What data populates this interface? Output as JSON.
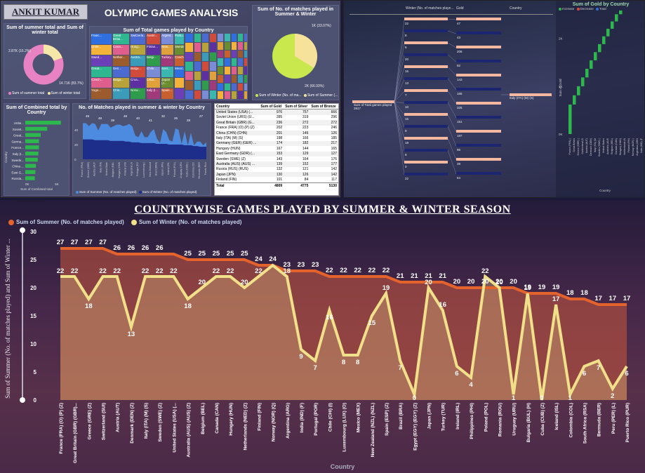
{
  "header": {
    "author": "ANKIT KUMAR",
    "title": "OLYMPIC GAMES ANALYSIS"
  },
  "colors": {
    "summer": "#e4622c",
    "winter": "#f1e08a",
    "green": "#2db84d",
    "pink": "#e882c2",
    "yellowgreen": "#c8e84d"
  },
  "donut": {
    "title": "Sum of summer total and Sum of winter total",
    "label_small": "2.87K (16.2%)",
    "label_large": "14.71K (83.7%)",
    "legend": [
      "Sum of summer total",
      "Sum of winter total"
    ]
  },
  "treemap": {
    "title": "Sum of Total games played by Country",
    "labels": [
      "Franc...",
      "Unite...",
      "Swed...",
      "Great...",
      "Czech...",
      "Yugo...",
      "Great Britai...",
      "Cana...",
      "Nether...",
      "Den...",
      "Bulga...",
      "Chin...",
      "Switzerla...",
      "Hung...",
      "Austra...",
      "Bulga...",
      "Croa...",
      "Norw...",
      "Austri...",
      "Finlan...",
      "Belgi...",
      "Chile...",
      "Leba...",
      "Italy (I...",
      "Argent...",
      "New...",
      "Turkey...",
      "Sovi...",
      "Japan (J...",
      "Spain...",
      "Portu...",
      "Swede...",
      "Czech...",
      "Mexic..."
    ]
  },
  "pie": {
    "title": "Sum of No. of matches played in Summer & Winter",
    "label_small": "1K (33.07%)",
    "label_large": "2K (66.93%)",
    "legend": [
      "Sum of Winter (No. of ma...",
      "Sum of Summer (..."
    ]
  },
  "hbar": {
    "title": "Sum of Combined total by Country",
    "ylabel": "Country",
    "xlabel": "Sum of Combined total",
    "ticks": [
      "0K",
      "5K"
    ],
    "categories": [
      "Unite...",
      "Soviet...",
      "Great...",
      "Germa...",
      "France...",
      "Italy (I...",
      "Swede...",
      "China ...",
      "East G...",
      "Russia..."
    ],
    "values": [
      6.0,
      3.7,
      2.6,
      2.3,
      2.3,
      2.2,
      2.1,
      1.8,
      1.7,
      1.6
    ]
  },
  "mini_area": {
    "title": "No. of Matches played in summer & winter by Country",
    "legend": [
      "Sum of Summer (No. of matches played)",
      "Sum of Winter (No. of matches played)"
    ],
    "ticks": [
      "0",
      "20",
      "40"
    ],
    "top_labels": [
      "49",
      "48",
      "39",
      "48",
      "40",
      "41",
      "32",
      "26",
      "28",
      "27"
    ]
  },
  "table": {
    "headers": [
      "Country",
      "Sum of Gold",
      "Sum of Silver",
      "Sum of Bronze"
    ],
    "rows": [
      [
        "United States (USA) (...",
        "976",
        "757",
        "666"
      ],
      [
        "Soviet Union (URS) (U...",
        "395",
        "319",
        "296"
      ],
      [
        "Great Britain (GBR) (G...",
        "236",
        "272",
        "272"
      ],
      [
        "France (FRA) (O) (P) (Z)",
        "202",
        "223",
        "246"
      ],
      [
        "China (CHN) (CHN)",
        "201",
        "146",
        "126"
      ],
      [
        "Italy (ITA) (M) (S)",
        "198",
        "166",
        "185"
      ],
      [
        "Germany (GER) (GER) ...",
        "174",
        "182",
        "217"
      ],
      [
        "Hungary (HUN)",
        "167",
        "144",
        "165"
      ],
      [
        "East Germany (GDR) (...",
        "153",
        "129",
        "127"
      ],
      [
        "Sweden (SWE) (Z)",
        "143",
        "164",
        "176"
      ],
      [
        "Australia (AUS) (AUS) ...",
        "139",
        "152",
        "177"
      ],
      [
        "Russia (RUS) (RUS)",
        "132",
        "121",
        "142"
      ],
      [
        "Japan (JPN)",
        "130",
        "126",
        "142"
      ],
      [
        "Finland (FIN)",
        "101",
        "84",
        "117"
      ]
    ],
    "total": [
      "Total",
      "4809",
      "4775",
      "5130"
    ]
  },
  "decomp": {
    "col1": "Winter (No. of matches playe...",
    "col2": "Gold",
    "col3": "Country",
    "root_label": "Sum of Total games played",
    "root_value": "2917",
    "left_values": [
      "22",
      "8",
      "6",
      "20",
      "16",
      "13",
      "7",
      "10",
      "15",
      "9",
      "19",
      "8",
      "0",
      "22"
    ],
    "mid_values": [
      "47",
      "43",
      "206",
      "82",
      "143",
      "165",
      "325",
      "151",
      "197",
      "96",
      "39",
      "64"
    ],
    "selected": "Italy (ITA) (M) (S)"
  },
  "waterfall": {
    "title": "Sum of Gold by Country",
    "legend": [
      "Increase",
      "Decrease",
      "Total"
    ],
    "ylabel": "Sum of Gold",
    "xlabel": "Country",
    "ticks": [
      "0K",
      "1K",
      "2K"
    ]
  },
  "main": {
    "title": "COUNTRYWISE GAMES PLAYED BY SUMMER & WINTER SEASON",
    "legend": [
      "Sum of Summer (No. of matches played)",
      "Sum of Winter (No. of matches played)"
    ],
    "ylabel": "Sum of Summer (No. of matches played) and Sum of Winter ...",
    "xlabel": "Country"
  },
  "chart_data": {
    "type": "line",
    "title": "COUNTRYWISE GAMES PLAYED BY SUMMER & WINTER SEASON",
    "xlabel": "Country",
    "ylabel": "Sum of Summer (No. of matches played) and Sum of Winter ...",
    "ylim": [
      0,
      30
    ],
    "yticks": [
      0,
      5,
      10,
      15,
      20,
      25,
      30
    ],
    "categories": [
      "France (FRA) (O) (P) (Z)",
      "Great Britain (GBR) (GBR)...",
      "Greece (GRE) (Z)",
      "Switzerland (SUI)",
      "Austria (AUT)",
      "Denmark (DEN) (Z)",
      "Italy (ITA) (M) (S)",
      "Sweden (SWE) (Z)",
      "United States (USA) (...",
      "Australia (AUS) (AUS) (Z)",
      "Belgium (BEL)",
      "Canada (CAN)",
      "Hungary (HUN)",
      "Netherlands (NED) (Z)",
      "Finland (FIN)",
      "Norway (NOR) (Q)",
      "Argentina (ARG)",
      "India (IND) (F)",
      "Portugal (POR)",
      "Chile (CHI) (I)",
      "Luxembourg (LUX) (O)",
      "Mexico (MEX)",
      "New Zealand (NZL) (NZL)",
      "Spain (ESP) (Z)",
      "Brazil (BRA)",
      "Egypt (EGY) (EGY) (Z)",
      "Japan (JPN)",
      "Turkey (TUR)",
      "Ireland (IRL)",
      "Philippines (PHI)",
      "Poland (POL)",
      "Romania (ROU)",
      "Uruguay (URU)",
      "Bulgaria (BUL) (H)",
      "Cuba (CUB) (Z)",
      "Iceland (ISL)",
      "Colombia (COL)",
      "South Africa (RSA)",
      "Bermuda (BER)",
      "Peru (PER) (L)",
      "Puerto Rico (PUR)"
    ],
    "series": [
      {
        "name": "Sum of Summer (No. of matches played)",
        "values": [
          27,
          27,
          27,
          27,
          26,
          26,
          26,
          26,
          26,
          25,
          25,
          25,
          25,
          25,
          24,
          24,
          23,
          23,
          23,
          22,
          22,
          22,
          22,
          22,
          21,
          21,
          21,
          21,
          20,
          20,
          20,
          20,
          20,
          19,
          19,
          19,
          18,
          18,
          17,
          17,
          17
        ]
      },
      {
        "name": "Sum of Winter (No. of matches played)",
        "values": [
          22,
          22,
          18,
          22,
          22,
          13,
          22,
          22,
          22,
          18,
          20,
          22,
          22,
          20,
          22,
          24,
          22,
          9,
          7,
          16,
          8,
          8,
          15,
          19,
          7,
          1,
          20,
          16,
          6,
          4,
          22,
          20,
          1,
          19,
          0,
          17,
          1,
          6,
          7,
          2,
          6
        ]
      }
    ],
    "summer_labels": [
      "27",
      "27",
      "27",
      "27",
      "26",
      "26",
      "26",
      "26",
      "",
      "25",
      "25",
      "25",
      "25",
      "25",
      "24",
      "24",
      "23",
      "23",
      "23",
      "22",
      "22",
      "22",
      "22",
      "22",
      "21",
      "21",
      "21",
      "21",
      "20",
      "20",
      "20",
      "20",
      "20",
      "19",
      "19",
      "19",
      "18",
      "18",
      "17",
      "17",
      "17"
    ],
    "winter_labels": [
      "22",
      "22",
      "18",
      "22",
      "22",
      "13",
      "22",
      "22",
      "22",
      "18",
      "20",
      "22",
      "22",
      "20",
      "22",
      "",
      "18",
      "9",
      "7",
      "16",
      "8",
      "8",
      "15",
      "19",
      "7",
      "0",
      "20",
      "16",
      "6",
      "4",
      "22",
      "20",
      "1",
      "19",
      "0",
      "17",
      "1",
      "6",
      "7",
      "2",
      "6"
    ],
    "grid": false,
    "legend_position": "top-left"
  }
}
